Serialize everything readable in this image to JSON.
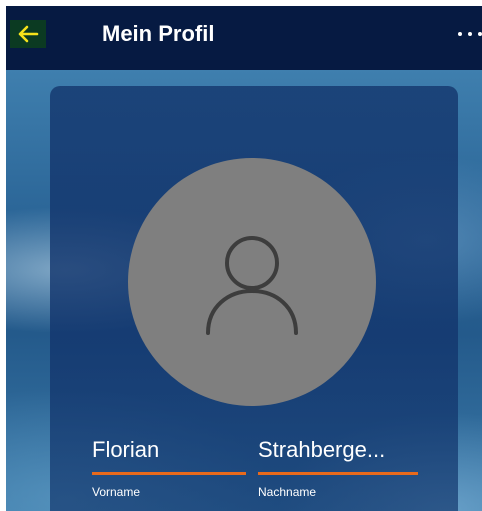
{
  "appbar": {
    "title": "Mein Profil",
    "back_icon": "arrow-left-icon",
    "more_icon": "more-horizontal-icon",
    "back_color": "#f5e21b"
  },
  "profile": {
    "avatar_icon": "person-icon",
    "first_name": {
      "value": "Florian",
      "label": "Vorname"
    },
    "last_name": {
      "value": "Strahberge...",
      "label": "Nachname"
    }
  },
  "colors": {
    "appbar_bg": "#061a42",
    "accent": "#e86a1c",
    "avatar_bg": "#7f7f7f"
  }
}
